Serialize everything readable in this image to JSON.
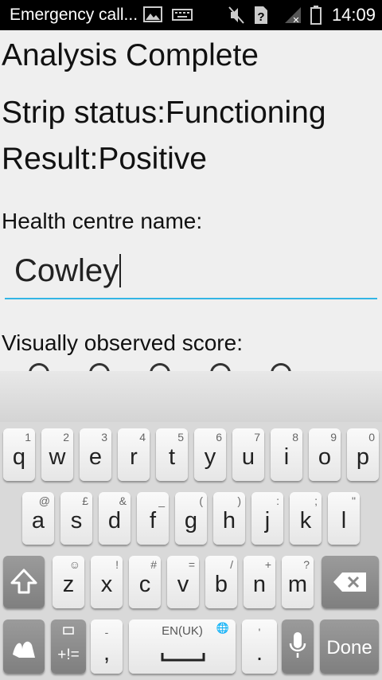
{
  "status_bar": {
    "title": "Emergency call...",
    "time": "14:09"
  },
  "screen": {
    "heading": "Analysis Complete",
    "strip_status": "Strip status:Functioning",
    "result": "Result:Positive",
    "health_centre_label": "Health centre name:",
    "health_centre_value": "Cowley",
    "visual_score_label": "Visually observed score:"
  },
  "keyboard": {
    "row1": [
      {
        "key": "q",
        "hint": "1"
      },
      {
        "key": "w",
        "hint": "2"
      },
      {
        "key": "e",
        "hint": "3"
      },
      {
        "key": "r",
        "hint": "4"
      },
      {
        "key": "t",
        "hint": "5"
      },
      {
        "key": "y",
        "hint": "6"
      },
      {
        "key": "u",
        "hint": "7"
      },
      {
        "key": "i",
        "hint": "8"
      },
      {
        "key": "o",
        "hint": "9"
      },
      {
        "key": "p",
        "hint": "0"
      }
    ],
    "row2": [
      {
        "key": "a",
        "hint": "@"
      },
      {
        "key": "s",
        "hint": "£"
      },
      {
        "key": "d",
        "hint": "&"
      },
      {
        "key": "f",
        "hint": "_"
      },
      {
        "key": "g",
        "hint": "("
      },
      {
        "key": "h",
        "hint": ")"
      },
      {
        "key": "j",
        "hint": ":"
      },
      {
        "key": "k",
        "hint": ";"
      },
      {
        "key": "l",
        "hint": "\""
      }
    ],
    "row3": [
      {
        "key": "z",
        "hint": "☺"
      },
      {
        "key": "x",
        "hint": "!"
      },
      {
        "key": "c",
        "hint": "#"
      },
      {
        "key": "v",
        "hint": "="
      },
      {
        "key": "b",
        "hint": "/"
      },
      {
        "key": "n",
        "hint": "+"
      },
      {
        "key": "m",
        "hint": "?"
      }
    ],
    "symbols_label": "+!=",
    "comma_label": ",",
    "comma_hint": "-",
    "space_label": "EN(UK)",
    "period_label": ".",
    "period_hint": "'",
    "done_label": "Done"
  },
  "colors": {
    "accent": "#33b5e5",
    "background": "#efefef"
  }
}
